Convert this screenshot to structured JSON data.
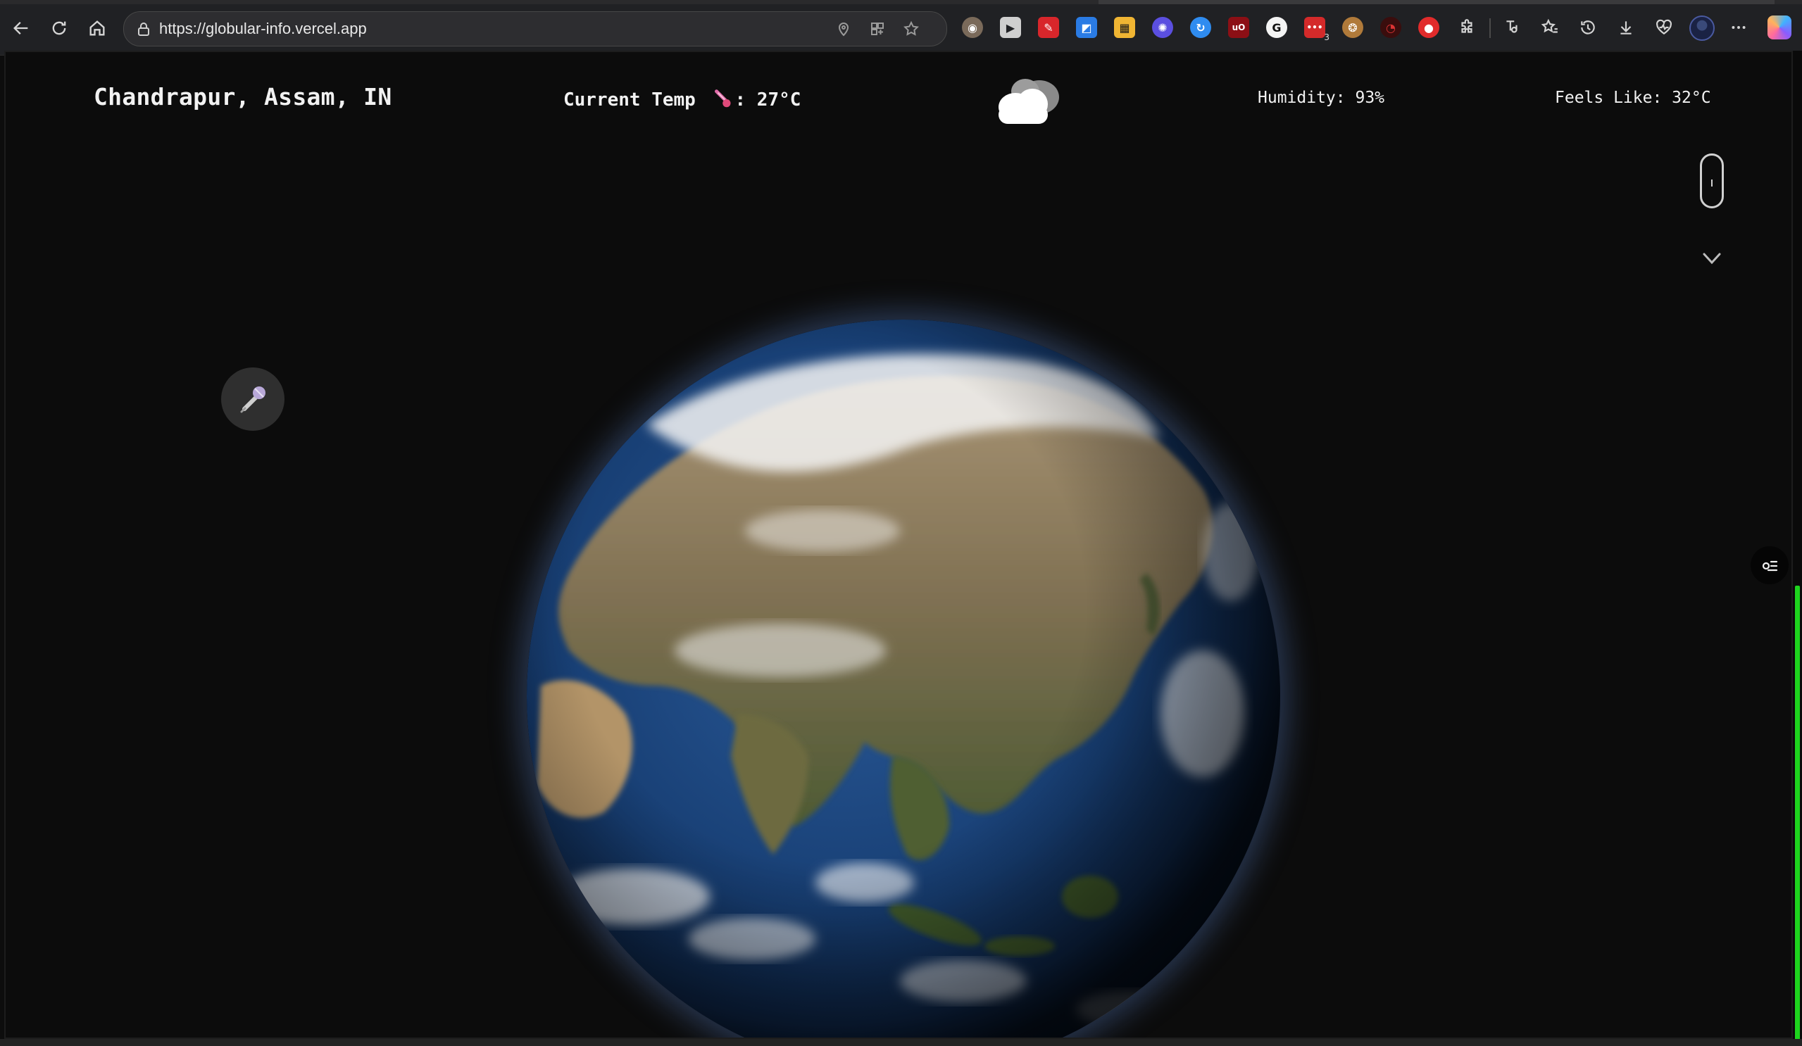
{
  "browser": {
    "url": "https://globular-info.vercel.app",
    "extensions_badge": "3"
  },
  "weather": {
    "location": "Chandrapur, Assam, IN",
    "temp_label": "Current Temp",
    "temp_value": ": 27°C",
    "humidity": "Humidity: 93%",
    "feels_like": "Feels Like: 32°C",
    "condition_icon": "cloud-icon"
  },
  "colors": {
    "page_background": "#0c0c0c",
    "text": "#f2f2f2",
    "scroll_indicator": "#1ed41e"
  },
  "globe": {
    "region_shown": "Asia"
  }
}
